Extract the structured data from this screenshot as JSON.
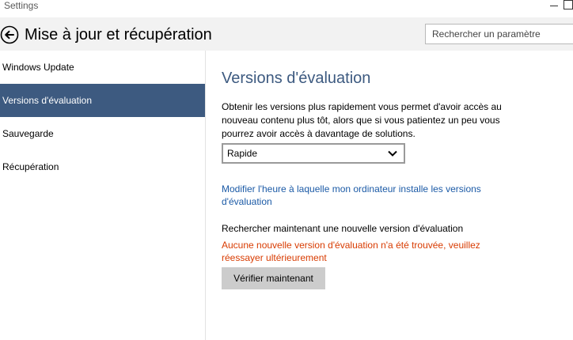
{
  "window": {
    "title": "Settings"
  },
  "header": {
    "title": "Mise à jour et récupération",
    "back_icon": "back-arrow-circle-icon"
  },
  "search": {
    "placeholder": "Rechercher un paramètre",
    "value": ""
  },
  "sidebar": {
    "items": [
      {
        "label": "Windows Update",
        "selected": false
      },
      {
        "label": "Versions d'évaluation",
        "selected": true
      },
      {
        "label": "Sauvegarde",
        "selected": false
      },
      {
        "label": "Récupération",
        "selected": false
      }
    ]
  },
  "main": {
    "title": "Versions d'évaluation",
    "description": "Obtenir les versions plus rapidement vous permet d'avoir accès au nouveau contenu plus tôt, alors que si vous patientez un peu vous pourrez avoir accès à davantage de solutions.",
    "speed_select": {
      "value": "Rapide"
    },
    "schedule_link": "Modifier l'heure à laquelle mon ordinateur installe les versions d'évaluation",
    "check_label": "Rechercher maintenant une nouvelle version d'évaluation",
    "error_message": "Aucune nouvelle version d'évaluation n'a été trouvée, veuillez réessayer ultérieurement",
    "check_button": "Vérifier maintenant"
  },
  "colors": {
    "accent": "#3d5a80",
    "link": "#1b5aa6",
    "error": "#d83b01",
    "header_bg": "#f2f2f2",
    "button_bg": "#cccccc"
  }
}
